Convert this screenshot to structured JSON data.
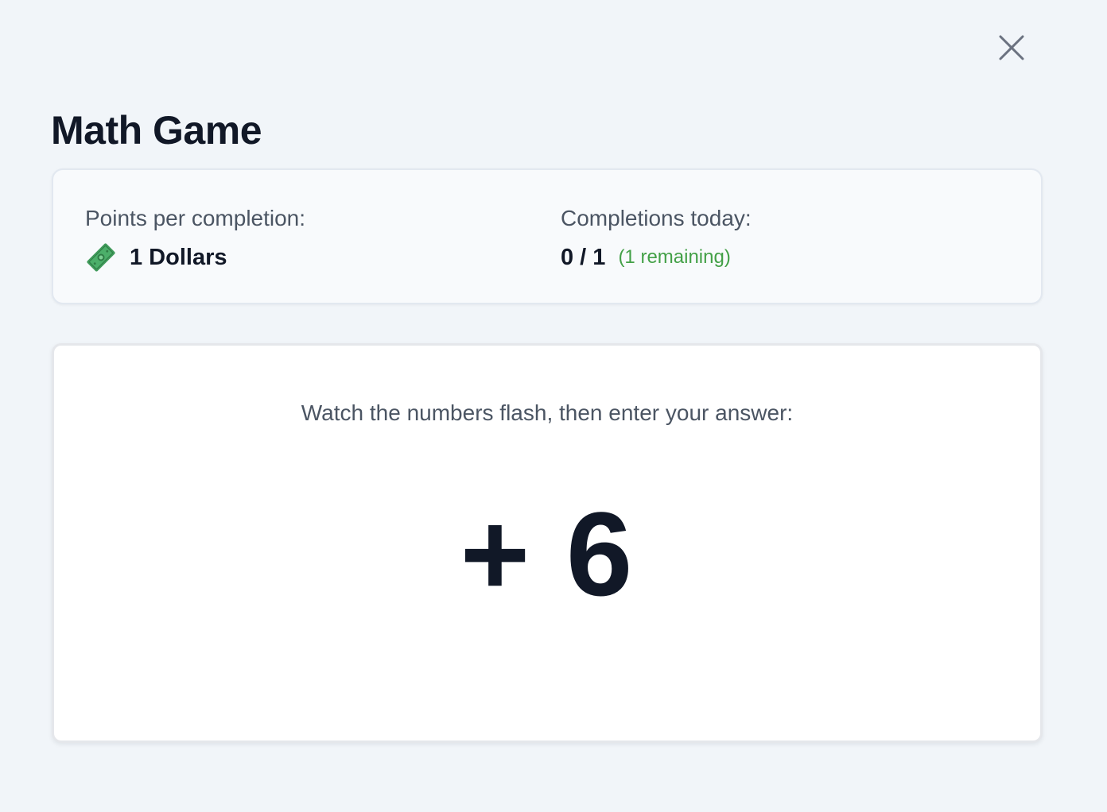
{
  "window": {
    "close_icon": "close-icon"
  },
  "header": {
    "title": "Math Game"
  },
  "info": {
    "points_label": "Points per completion:",
    "points_icon": "money-icon",
    "points_value": "1 Dollars",
    "completions_label": "Completions today:",
    "completions_value": "0 / 1",
    "remaining_text": "(1 remaining)",
    "remaining_color": "#43a047"
  },
  "game": {
    "instructions": "Watch the numbers flash, then enter your answer:",
    "flash_number": "+ 6"
  }
}
